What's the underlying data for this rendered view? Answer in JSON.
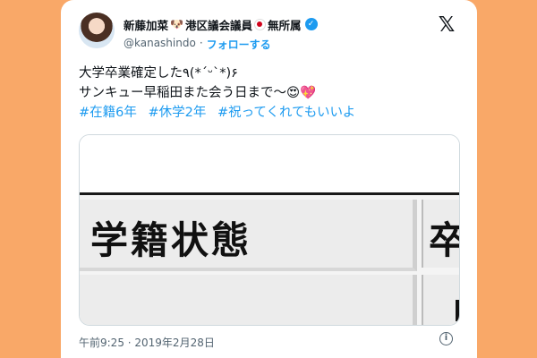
{
  "author": {
    "display_name": "新藤加菜",
    "dog_emoji": "🐶",
    "title_text": "港区議会議員",
    "party_text": "無所属",
    "handle": "@kanashindo",
    "separator": "·",
    "follow_label": "フォローする",
    "avatar_icon": "avatar-photo"
  },
  "logo": {
    "symbol": "𝕏",
    "icon": "x-logo-icon"
  },
  "tweet": {
    "line1": "大学卒業確定した٩(*ˊᵕˋ*)۶",
    "line2": "サンキュー早稲田また会う日まで〜😍💖",
    "hashtags": [
      "#在籍6年",
      "#休学2年",
      "#祝ってくれてもいいよ"
    ]
  },
  "media": {
    "cell_label": "学籍状態",
    "cell_label_partial": "卒"
  },
  "footer": {
    "timestamp": "午前9:25 · 2019年2月28日",
    "info_symbol": "i",
    "info_icon": "info-icon"
  },
  "colors": {
    "background": "#f9a868",
    "accent_blue": "#1d9bf0",
    "text_primary": "#0f1419",
    "text_secondary": "#536471"
  }
}
